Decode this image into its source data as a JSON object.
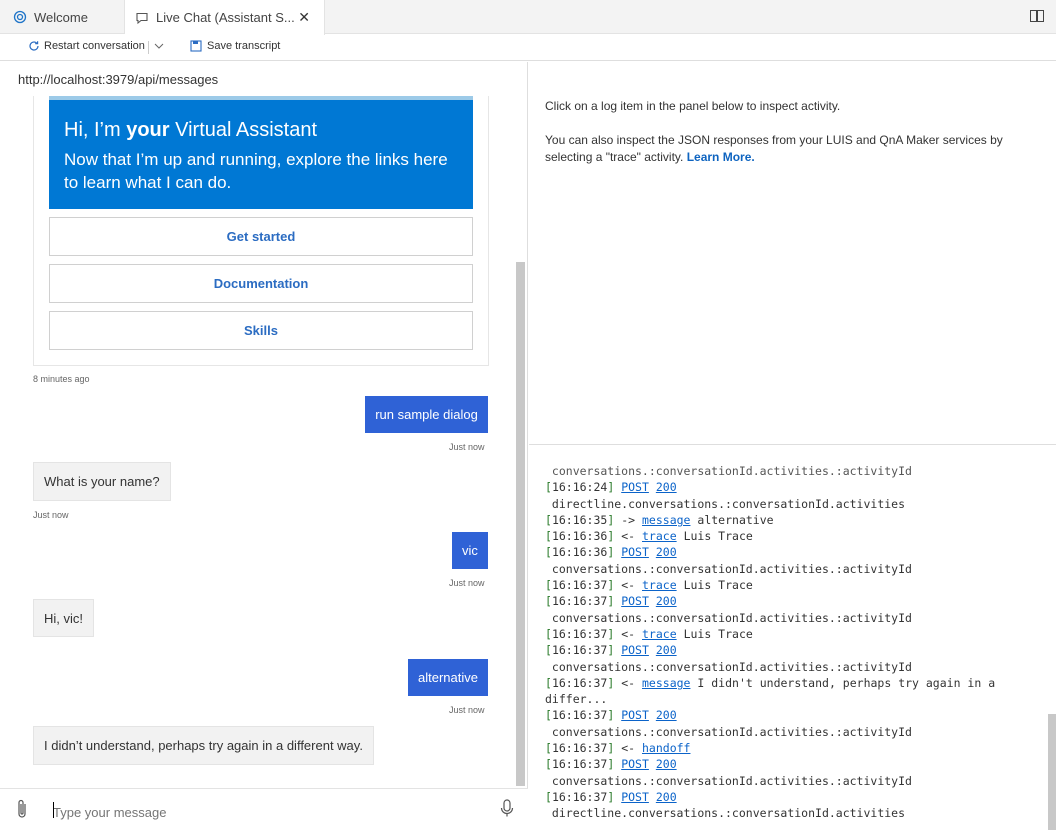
{
  "tabs": [
    {
      "label": "Welcome",
      "icon": "emulator-icon",
      "active": false
    },
    {
      "label": "Live Chat (Assistant S...",
      "icon": "chat-icon",
      "active": true
    }
  ],
  "toolbar": {
    "restart_label": "Restart conversation",
    "save_label": "Save transcript"
  },
  "chat": {
    "endpoint": "http://localhost:3979/api/messages",
    "hero": {
      "title_prefix": "Hi, I’m ",
      "title_bold": "your",
      "title_suffix": " Virtual Assistant",
      "text": "Now that I’m up and running, explore the links here to learn what I can do."
    },
    "card_buttons": [
      "Get started",
      "Documentation",
      "Skills"
    ],
    "card_timestamp": "8 minutes ago",
    "messages": [
      {
        "from": "user",
        "text": "run sample dialog",
        "time": "Just now"
      },
      {
        "from": "bot",
        "text": "What is your name?",
        "time": "Just now"
      },
      {
        "from": "user",
        "text": "vic",
        "time": "Just now"
      },
      {
        "from": "bot",
        "text": "Hi, vic!",
        "time": ""
      },
      {
        "from": "user",
        "text": "alternative",
        "time": "Just now"
      },
      {
        "from": "bot",
        "text": "I didn’t understand, perhaps try again in a different way.",
        "time": ""
      }
    ],
    "input_placeholder": "Type your message"
  },
  "inspector": {
    "line1": "Click on a log item in the panel below to inspect activity.",
    "line2_text": "You can also inspect the JSON responses from your LUIS and QnA Maker services by selecting a \"trace\" activity.",
    "learn_more": "Learn More."
  },
  "log": {
    "partial_top": "conversations.:conversationId.activities.:activityId",
    "lines": [
      {
        "ts": "[16:16:24]",
        "link": "POST",
        "code": "200",
        "rest": ""
      },
      {
        "cont": "directline.conversations.:conversationId.activities"
      },
      {
        "ts": "[16:16:35]",
        "arrow": "->",
        "link": "message",
        "rest": "alternative"
      },
      {
        "ts": "[16:16:36]",
        "arrow": "<-",
        "link": "trace",
        "rest": "Luis Trace"
      },
      {
        "ts": "[16:16:36]",
        "link": "POST",
        "code": "200",
        "rest": ""
      },
      {
        "cont": "conversations.:conversationId.activities.:activityId"
      },
      {
        "ts": "[16:16:37]",
        "arrow": "<-",
        "link": "trace",
        "rest": "Luis Trace"
      },
      {
        "ts": "[16:16:37]",
        "link": "POST",
        "code": "200",
        "rest": ""
      },
      {
        "cont": "conversations.:conversationId.activities.:activityId"
      },
      {
        "ts": "[16:16:37]",
        "arrow": "<-",
        "link": "trace",
        "rest": "Luis Trace"
      },
      {
        "ts": "[16:16:37]",
        "link": "POST",
        "code": "200",
        "rest": ""
      },
      {
        "cont": "conversations.:conversationId.activities.:activityId"
      },
      {
        "ts": "[16:16:37]",
        "arrow": "<-",
        "link": "message",
        "rest": "I didn't understand, perhaps try again in a"
      },
      {
        "wrap": "differ..."
      },
      {
        "ts": "[16:16:37]",
        "link": "POST",
        "code": "200",
        "rest": ""
      },
      {
        "cont": "conversations.:conversationId.activities.:activityId"
      },
      {
        "ts": "[16:16:37]",
        "arrow": "<-",
        "link": "handoff",
        "rest": ""
      },
      {
        "ts": "[16:16:37]",
        "link": "POST",
        "code": "200",
        "rest": ""
      },
      {
        "cont": "conversations.:conversationId.activities.:activityId"
      },
      {
        "ts": "[16:16:37]",
        "link": "POST",
        "code": "200",
        "rest": ""
      },
      {
        "cont": "directline.conversations.:conversationId.activities"
      }
    ]
  },
  "colors": {
    "hero_bg": "#0078d4",
    "user_bubble": "#2f62d6",
    "link": "#0b63c9"
  }
}
